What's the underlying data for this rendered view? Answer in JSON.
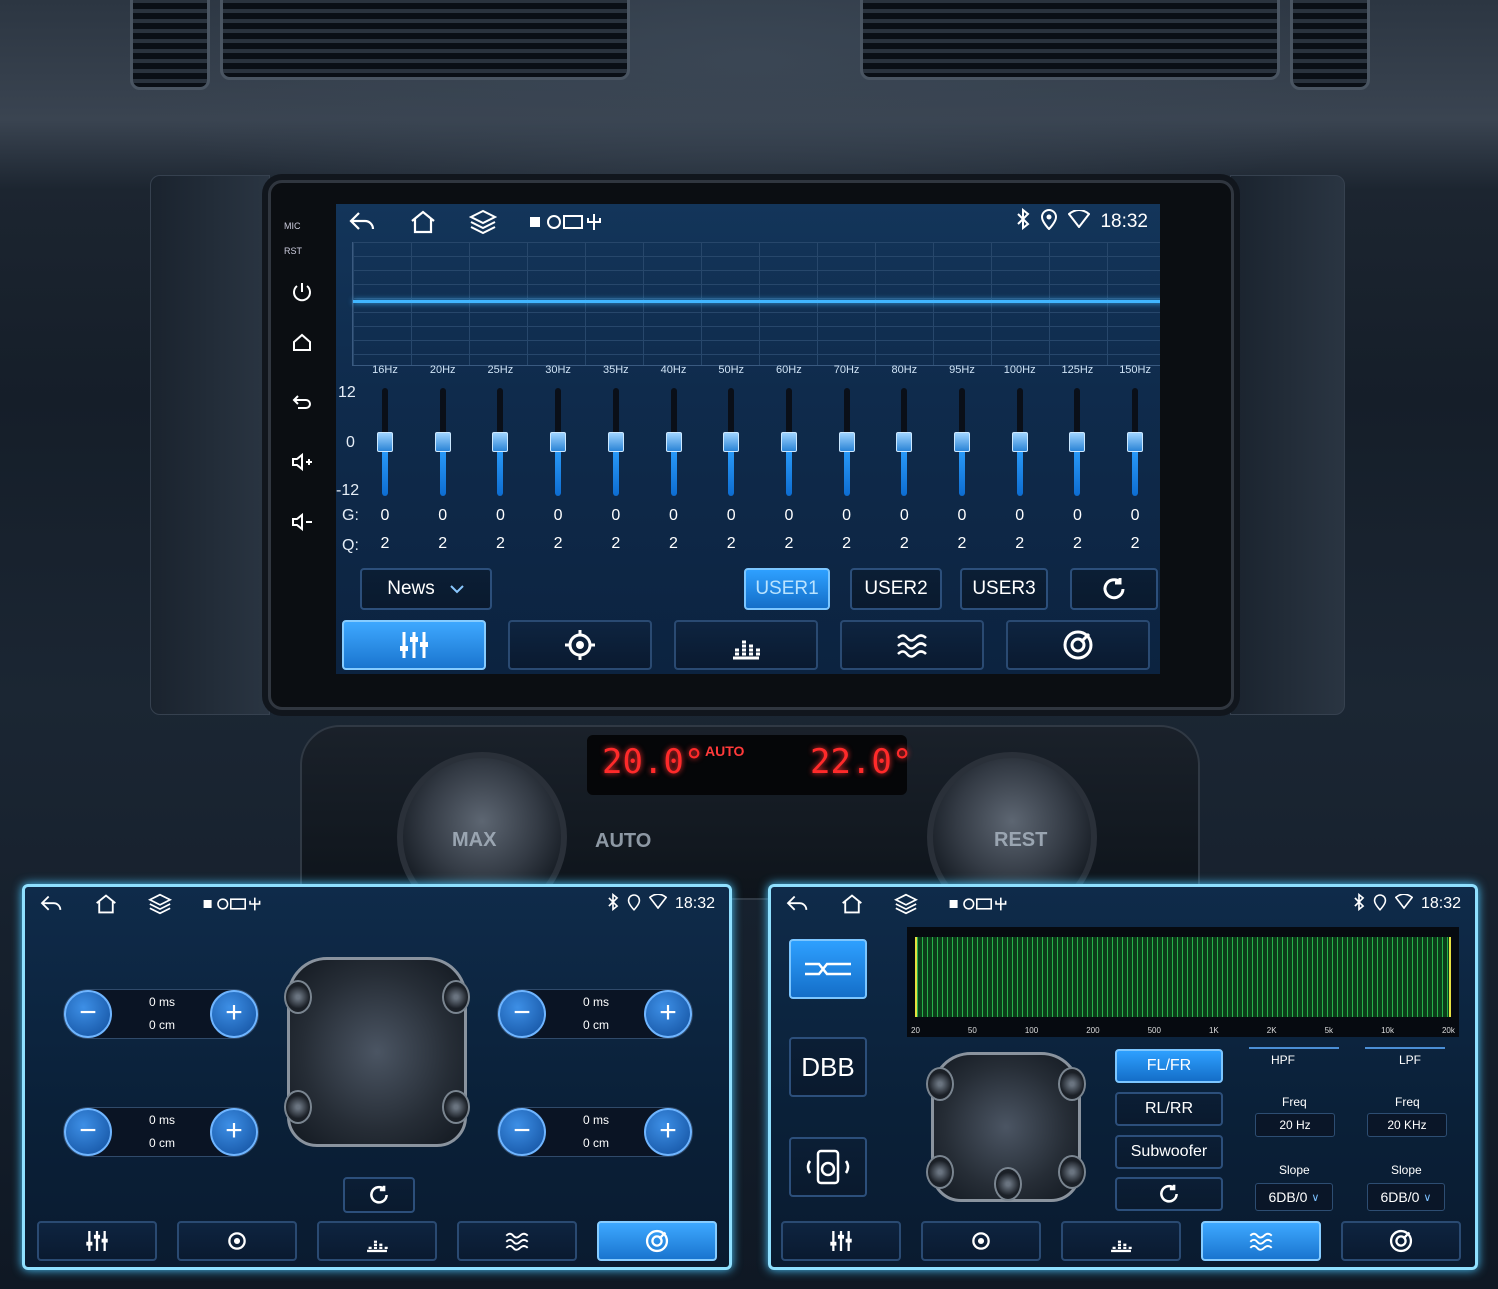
{
  "main": {
    "status": {
      "time": "18:32"
    },
    "left_side": {
      "mic": "MIC",
      "rst": "RST"
    },
    "frequencies": [
      "16Hz",
      "20Hz",
      "25Hz",
      "30Hz",
      "35Hz",
      "40Hz",
      "50Hz",
      "60Hz",
      "70Hz",
      "80Hz",
      "95Hz",
      "100Hz",
      "125Hz",
      "150Hz"
    ],
    "gain_values": [
      "0",
      "0",
      "0",
      "0",
      "0",
      "0",
      "0",
      "0",
      "0",
      "0",
      "0",
      "0",
      "0",
      "0"
    ],
    "q_values": [
      "2",
      "2",
      "2",
      "2",
      "2",
      "2",
      "2",
      "2",
      "2",
      "2",
      "2",
      "2",
      "2",
      "2"
    ],
    "scale": {
      "top": "12",
      "mid": "0",
      "bottom": "-12"
    },
    "row_labels": {
      "g": "G:",
      "q": "Q:"
    },
    "preset": {
      "selected": "News"
    },
    "user_buttons": [
      "USER1",
      "USER2",
      "USER3"
    ],
    "active_user": "USER1",
    "tabs": [
      "equalizer-icon",
      "balance-icon",
      "spectrum-icon",
      "crossover-icon",
      "sound-field-icon"
    ],
    "active_tab": 0
  },
  "climate": {
    "left_temp": "20.0°",
    "right_temp": "22.0°",
    "auto_label": "AUTO",
    "auto_button": "AUTO",
    "left_dial": "MAX",
    "right_dial": "REST"
  },
  "delay_panel": {
    "status": {
      "time": "18:32"
    },
    "speakers": [
      {
        "ms": "0 ms",
        "cm": "0 cm"
      },
      {
        "ms": "0 ms",
        "cm": "0 cm"
      },
      {
        "ms": "0 ms",
        "cm": "0 cm"
      },
      {
        "ms": "0 ms",
        "cm": "0 cm"
      }
    ],
    "active_tab": 4
  },
  "crossover_panel": {
    "status": {
      "time": "18:32"
    },
    "dbb_label": "DBB",
    "spectrum_ticks": [
      "20",
      "50",
      "100",
      "200",
      "500",
      "1K",
      "2K",
      "5k",
      "10k",
      "20k"
    ],
    "channels": [
      "FL/FR",
      "RL/RR",
      "Subwoofer"
    ],
    "active_channel": "FL/FR",
    "hpf": {
      "label": "HPF",
      "freq_label": "Freq",
      "freq": "20 Hz",
      "slope_label": "Slope",
      "slope": "6DB/0"
    },
    "lpf": {
      "label": "LPF",
      "freq_label": "Freq",
      "freq": "20 KHz",
      "slope_label": "Slope",
      "slope": "6DB/0"
    },
    "active_tab": 3
  },
  "colors": {
    "accent": "#2ea0ff",
    "panel_border": "#8fe0ff",
    "climate_red": "#ff2a2a"
  }
}
